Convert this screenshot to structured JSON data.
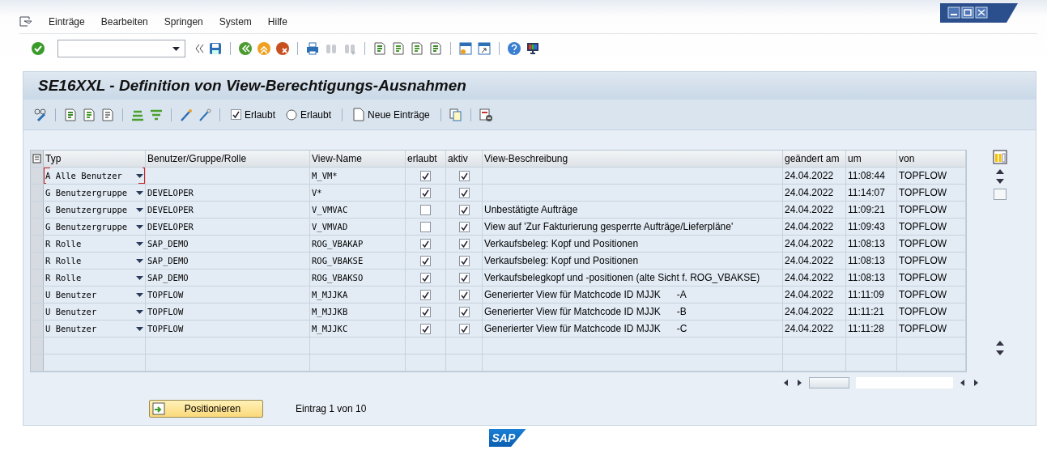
{
  "menu": [
    "Einträge",
    "Bearbeiten",
    "Springen",
    "System",
    "Hilfe"
  ],
  "title": "SE16XXL - Definition von View-Berechtigungs-Ausnahmen",
  "app_toolbar": {
    "checkbox": {
      "label": "Erlaubt",
      "checked": true
    },
    "radio": {
      "label": "Erlaubt",
      "selected": false
    },
    "new_entries": "Neue Einträge"
  },
  "table": {
    "columns": [
      "Typ",
      "Benutzer/Gruppe/Rolle",
      "View-Name",
      "erlaubt",
      "aktiv",
      "View-Beschreibung",
      "geändert am",
      "um",
      "von"
    ],
    "rows": [
      {
        "typ": "A Alle Benutzer",
        "focused": true,
        "user": "",
        "view": "M_VM*",
        "erlaubt": true,
        "aktiv": true,
        "desc": "",
        "date": "24.04.2022",
        "time": "11:08:44",
        "by": "TOPFLOW"
      },
      {
        "typ": "G Benutzergruppe",
        "focused": false,
        "user": "DEVELOPER",
        "view": "V*",
        "erlaubt": true,
        "aktiv": true,
        "desc": "",
        "date": "24.04.2022",
        "time": "11:14:07",
        "by": "TOPFLOW"
      },
      {
        "typ": "G Benutzergruppe",
        "focused": false,
        "user": "DEVELOPER",
        "view": "V_VMVAC",
        "erlaubt": false,
        "aktiv": true,
        "desc": "Unbestätigte Aufträge",
        "date": "24.04.2022",
        "time": "11:09:21",
        "by": "TOPFLOW"
      },
      {
        "typ": "G Benutzergruppe",
        "focused": false,
        "user": "DEVELOPER",
        "view": "V_VMVAD",
        "erlaubt": false,
        "aktiv": true,
        "desc": "View auf 'Zur Fakturierung gesperrte Aufträge/Lieferpläne'",
        "date": "24.04.2022",
        "time": "11:09:43",
        "by": "TOPFLOW"
      },
      {
        "typ": "R Rolle",
        "focused": false,
        "user": "SAP_DEMO",
        "view": "ROG_VBAKAP",
        "erlaubt": true,
        "aktiv": true,
        "desc": "Verkaufsbeleg: Kopf und Positionen",
        "date": "24.04.2022",
        "time": "11:08:13",
        "by": "TOPFLOW"
      },
      {
        "typ": "R Rolle",
        "focused": false,
        "user": "SAP_DEMO",
        "view": "ROG_VBAKSE",
        "erlaubt": true,
        "aktiv": true,
        "desc": "Verkaufsbeleg: Kopf und Positionen",
        "date": "24.04.2022",
        "time": "11:08:13",
        "by": "TOPFLOW"
      },
      {
        "typ": "R Rolle",
        "focused": false,
        "user": "SAP_DEMO",
        "view": "ROG_VBAKSO",
        "erlaubt": true,
        "aktiv": true,
        "desc": "Verkaufsbelegkopf und -positionen (alte Sicht f. ROG_VBAKSE)",
        "date": "24.04.2022",
        "time": "11:08:13",
        "by": "TOPFLOW"
      },
      {
        "typ": "U Benutzer",
        "focused": false,
        "user": "TOPFLOW",
        "view": "M_MJJKA",
        "erlaubt": true,
        "aktiv": true,
        "desc": "Generierter View für Matchcode ID MJJK      -A",
        "date": "24.04.2022",
        "time": "11:11:09",
        "by": "TOPFLOW"
      },
      {
        "typ": "U Benutzer",
        "focused": false,
        "user": "TOPFLOW",
        "view": "M_MJJKB",
        "erlaubt": true,
        "aktiv": true,
        "desc": "Generierter View für Matchcode ID MJJK      -B",
        "date": "24.04.2022",
        "time": "11:11:21",
        "by": "TOPFLOW"
      },
      {
        "typ": "U Benutzer",
        "focused": false,
        "user": "TOPFLOW",
        "view": "M_MJJKC",
        "erlaubt": true,
        "aktiv": true,
        "desc": "Generierter View für Matchcode ID MJJK      -C",
        "date": "24.04.2022",
        "time": "11:11:28",
        "by": "TOPFLOW"
      }
    ]
  },
  "position_button": "Positionieren",
  "entry_count": "Eintrag 1 von 10",
  "logo": "SAP"
}
